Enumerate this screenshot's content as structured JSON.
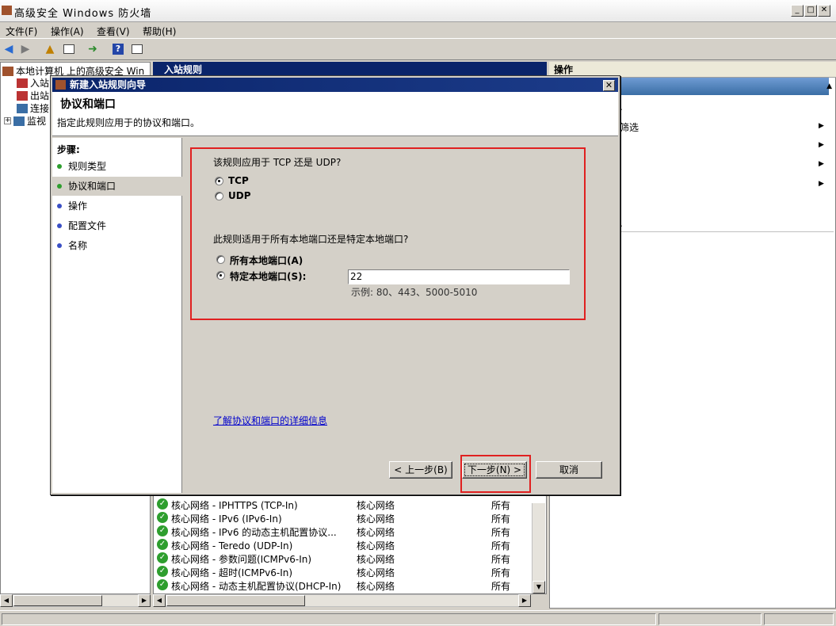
{
  "window": {
    "title": "高级安全 Windows 防火墙"
  },
  "menu": [
    "文件(F)",
    "操作(A)",
    "查看(V)",
    "帮助(H)"
  ],
  "tree": {
    "root": "本地计算机 上的高级安全 Win",
    "items": [
      "入站",
      "出站",
      "连接",
      "监视"
    ]
  },
  "middle": {
    "header": "入站规则",
    "rows": [
      {
        "name": "核心网络 - IPHTTPS (TCP-In)",
        "group": "核心网络",
        "profile": "所有"
      },
      {
        "name": "核心网络 - IPv6 (IPv6-In)",
        "group": "核心网络",
        "profile": "所有"
      },
      {
        "name": "核心网络 - IPv6 的动态主机配置协议...",
        "group": "核心网络",
        "profile": "所有"
      },
      {
        "name": "核心网络 - Teredo (UDP-In)",
        "group": "核心网络",
        "profile": "所有"
      },
      {
        "name": "核心网络 - 参数问题(ICMPv6-In)",
        "group": "核心网络",
        "profile": "所有"
      },
      {
        "name": "核心网络 - 超时(ICMPv6-In)",
        "group": "核心网络",
        "profile": "所有"
      },
      {
        "name": "核心网络 - 动态主机配置协议(DHCP-In)",
        "group": "核心网络",
        "profile": "所有"
      }
    ]
  },
  "right": {
    "header": "操作",
    "items": [
      ".",
      "筛选",
      "",
      "",
      "",
      ".",
      "."
    ]
  },
  "dialog": {
    "title": "新建入站规则向导",
    "heading": "协议和端口",
    "subheading": "指定此规则应用于的协议和端口。",
    "steps_title": "步骤:",
    "steps": [
      "规则类型",
      "协议和端口",
      "操作",
      "配置文件",
      "名称"
    ],
    "q1": "该规则应用于 TCP 还是 UDP?",
    "tcp": "TCP",
    "udp": "UDP",
    "q2": "此规则适用于所有本地端口还是特定本地端口?",
    "all_ports": "所有本地端口(A)",
    "specific_ports": "特定本地端口(S):",
    "port_value": "22",
    "example": "示例: 80、443、5000-5010",
    "link": "了解协议和端口的详细信息",
    "back": "< 上一步(B)",
    "next": "下一步(N) >",
    "cancel": "取消"
  },
  "colors": {
    "accent": "#0a246a",
    "highlight": "#e02020",
    "ok": "#2e9e2e"
  }
}
